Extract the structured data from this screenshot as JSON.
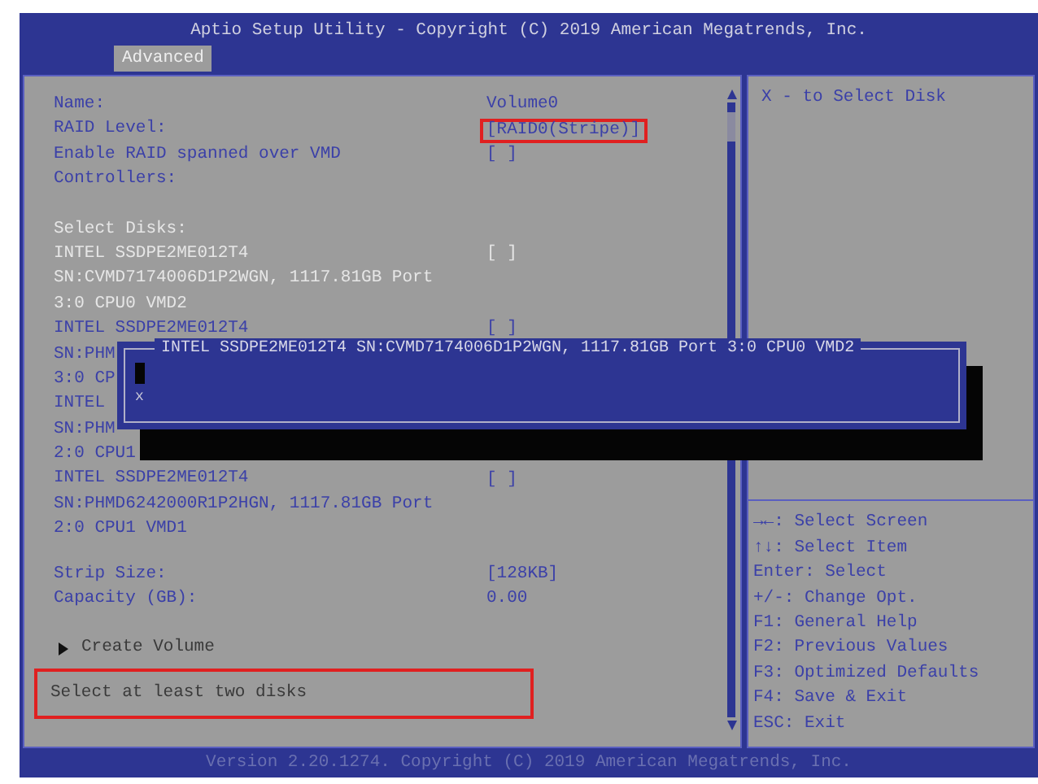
{
  "header": {
    "title": "Aptio Setup Utility - Copyright (C) 2019 American Megatrends, Inc.",
    "tabs": [
      {
        "label": "Advanced",
        "selected": true
      }
    ]
  },
  "settings": [
    {
      "label": "Name:",
      "value": "Volume0",
      "outlined": false
    },
    {
      "label": "RAID Level:",
      "value": "[RAID0(Stripe)]",
      "outlined": true
    },
    {
      "label": "Enable RAID spanned over VMD",
      "value": "[ ]",
      "outlined": false
    },
    {
      "label": "Controllers:"
    }
  ],
  "select_disks": {
    "heading": "Select Disks:",
    "disks": [
      {
        "lines": [
          "INTEL SSDPE2ME012T4",
          "SN:CVMD7174006D1P2WGN, 1117.81GB Port",
          "3:0 CPU0 VMD2"
        ],
        "value": "[ ]",
        "checked": false,
        "selected": true
      },
      {
        "lines": [
          "INTEL SSDPE2ME012T4",
          "SN:PHM",
          "3:0 CP"
        ],
        "value": "[ ]",
        "checked": false,
        "selected": false
      },
      {
        "lines": [
          "INTEL",
          "SN:PHM",
          "2:0 CPU1"
        ],
        "selected": false
      },
      {
        "lines": [
          "INTEL SSDPE2ME012T4",
          "SN:PHMD6242000R1P2HGN, 1117.81GB Port",
          "2:0 CPU1 VMD1"
        ],
        "value": "[ ]",
        "checked": false,
        "selected": false
      }
    ]
  },
  "settings_2": [
    {
      "label": "Strip Size:",
      "value": "[128KB]",
      "outlined": false
    },
    {
      "label": "Capacity (GB):",
      "value": "0.00",
      "outlined": false
    }
  ],
  "submenu": {
    "label": "Create Volume"
  },
  "message": {
    "text": "Select at least two disks",
    "outlined": true
  },
  "help": {
    "text": "X - to Select Disk"
  },
  "keys": [
    "→←: Select Screen",
    "↑↓: Select Item",
    "Enter: Select",
    "+/-: Change Opt.",
    "F1: General Help",
    "F2: Previous Values",
    "F3: Optimized Defaults",
    "F4: Save & Exit",
    "ESC: Exit"
  ],
  "popup": {
    "title": "INTEL SSDPE2ME012T4 SN:CVMD7174006D1P2WGN, 1117.81GB Port 3:0 CPU0 VMD2",
    "options": [
      {
        "kind": "blank",
        "selected": true
      },
      {
        "kind": "text",
        "label": "x",
        "selected": false
      }
    ]
  },
  "footer": "Version 2.20.1274. Copyright (C) 2019 American Megatrends, Inc."
}
